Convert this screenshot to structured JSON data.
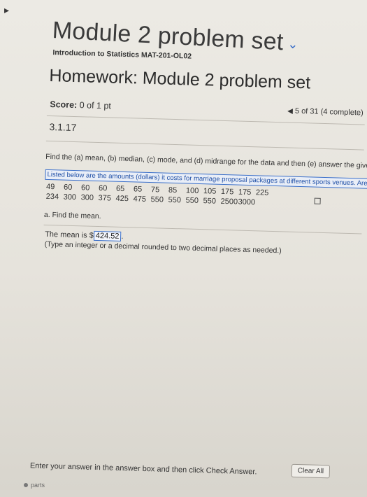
{
  "module": {
    "title": "Module 2 problem set",
    "chevron_icon": "chevron-down-icon"
  },
  "course": "Introduction to Statistics MAT-201-OL02",
  "homework": {
    "title": "Homework: Module 2 problem set"
  },
  "score": {
    "label": "Score:",
    "value": "0 of 1 pt"
  },
  "progress": {
    "text": "5 of 31 (4 complete)"
  },
  "problem": {
    "number": "3.1.17",
    "question": "Find the (a) mean, (b) median, (c) mode, and (d) midrange for the data and then (e) answer the given question.",
    "listed": "Listed below are the amounts (dollars) it costs for marriage proposal packages at different sports venues. Are there any outliers?",
    "row1": [
      "49",
      "60",
      "60",
      "60",
      "65",
      "65",
      "75",
      "85",
      "100",
      "105",
      "175",
      "175",
      "225"
    ],
    "row2": [
      "234",
      "300",
      "300",
      "375",
      "425",
      "475",
      "550",
      "550",
      "550",
      "550",
      "2500",
      "3000"
    ]
  },
  "part_a": {
    "label": "a. Find the mean.",
    "mean_prefix": "The mean is $",
    "mean_value": "424.52",
    "mean_suffix": ".",
    "hint": "(Type an integer or a decimal rounded to two decimal places as needed.)"
  },
  "footer": {
    "instruction": "Enter your answer in the answer box and then click Check Answer.",
    "parts": "parts",
    "clear_all": "Clear All"
  }
}
